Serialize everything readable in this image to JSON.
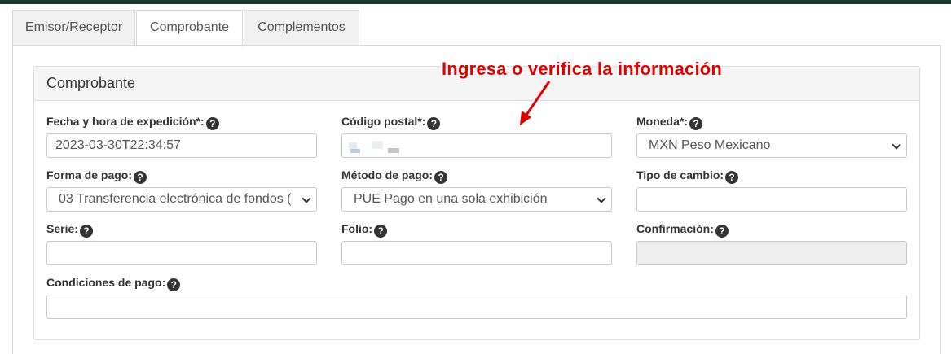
{
  "tabs": [
    {
      "label": "Emisor/Receptor"
    },
    {
      "label": "Comprobante"
    },
    {
      "label": "Complementos"
    }
  ],
  "active_tab": "Comprobante",
  "panel": {
    "title": "Comprobante"
  },
  "annotation": {
    "text": "Ingresa o verifica la información",
    "color": "#e00000"
  },
  "fields": {
    "fecha": {
      "label": "Fecha y hora de expedición*:",
      "value": "2023-03-30T22:34:57"
    },
    "codigo_postal": {
      "label": "Código postal*:",
      "value": ""
    },
    "moneda": {
      "label": "Moneda*:",
      "value": "MXN Peso Mexicano"
    },
    "forma_pago": {
      "label": "Forma de pago:",
      "value": "03 Transferencia electrónica de fondos ("
    },
    "metodo_pago": {
      "label": "Método de pago:",
      "value": "PUE Pago en una sola exhibición"
    },
    "tipo_cambio": {
      "label": "Tipo de cambio:",
      "value": ""
    },
    "serie": {
      "label": "Serie:",
      "value": ""
    },
    "folio": {
      "label": "Folio:",
      "value": ""
    },
    "confirmacion": {
      "label": "Confirmación:",
      "value": ""
    },
    "condiciones": {
      "label": "Condiciones de pago:",
      "value": ""
    }
  },
  "help_glyph": "?",
  "colors": {
    "topbar": "#1e3a2f",
    "annotation": "#e00000",
    "disabled_bg": "#eeeeee"
  }
}
